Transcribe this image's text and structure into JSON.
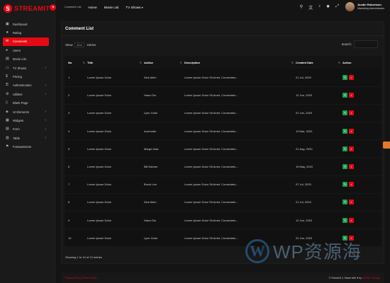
{
  "brand": {
    "name": "STREAMIT",
    "mark": "S"
  },
  "sidebar": {
    "items": [
      {
        "label": "Dashboard",
        "icon": "dashboard-icon",
        "glyph": "▣"
      },
      {
        "label": "Rating",
        "icon": "star-icon",
        "glyph": "★"
      },
      {
        "label": "Comments",
        "icon": "comment-icon",
        "glyph": "✉",
        "active": true
      },
      {
        "label": "Users",
        "icon": "user-icon",
        "glyph": "●"
      },
      {
        "label": "Movie List",
        "icon": "film-icon",
        "glyph": "▤"
      },
      {
        "label": "TV Shows",
        "icon": "tv-icon",
        "glyph": "▭",
        "chevron": true
      },
      {
        "label": "Pricing",
        "icon": "price-icon",
        "glyph": "$"
      },
      {
        "label": "Authentication",
        "icon": "lock-icon",
        "glyph": "⚿",
        "chevron": true
      },
      {
        "label": "Utilities",
        "icon": "tool-icon",
        "glyph": "⚙",
        "chevron": true
      },
      {
        "label": "Blank Page",
        "icon": "page-icon",
        "glyph": "▯"
      },
      {
        "label": "UI Elements",
        "icon": "layers-icon",
        "glyph": "◈",
        "chevron": true
      },
      {
        "label": "Widgets",
        "icon": "widget-icon",
        "glyph": "▦",
        "chevron": true
      },
      {
        "label": "Form",
        "icon": "form-icon",
        "glyph": "▤",
        "chevron": true
      },
      {
        "label": "Table",
        "icon": "table-icon",
        "glyph": "▥",
        "chevron": true
      },
      {
        "label": "Fontawesome",
        "icon": "flag-icon",
        "glyph": "⚑"
      }
    ]
  },
  "topbar": {
    "links": [
      "Comment List",
      "Home",
      "Movie List",
      "TV Shows"
    ],
    "user_name": "Austin Robertson",
    "user_role": "Marketing Administrator"
  },
  "card": {
    "title": "Comment List",
    "show_label": "Show",
    "show_value": "10",
    "entries_label": "entries",
    "search_label": "Search:",
    "info": "Showing 1 to 10 of 12 entries"
  },
  "table": {
    "headers": [
      "No",
      "Title",
      "Author",
      "Description",
      "Created Date",
      "Action"
    ],
    "rows": [
      {
        "no": "1",
        "title": "Lorem Ipsum Dolor",
        "author": "Nick Allen",
        "desc": "Lorem Ipsum Dolor Sit Amet, Consectetu...",
        "date": "21 Jul, 2020"
      },
      {
        "no": "2",
        "title": "Lorem Ipsum Dolor",
        "author": "Hana Olo",
        "desc": "Lorem Ipsum Dolor Sit Amet, Consectetu...",
        "date": "12 Jun, 2020"
      },
      {
        "no": "3",
        "title": "Lorem Ipsum Dolor",
        "author": "Lynn Guini",
        "desc": "Lorem Ipsum Dolor Sit Amet, Consectetu...",
        "date": "01 Jun, 2020"
      },
      {
        "no": "4",
        "title": "Lorem Ipsum Dolor",
        "author": "Aorrinotto",
        "desc": "Lorem Ipsum Dolor Sit Amet, Consectetu...",
        "date": "19 Mar, 2020"
      },
      {
        "no": "5",
        "title": "Lorem Ipsum Dolor",
        "author": "Marge Arita",
        "desc": "Lorem Ipsum Dolor Sit Amet, Consectetu...",
        "date": "21 Aug, 2020"
      },
      {
        "no": "6",
        "title": "Lorem Ipsum Dolor",
        "author": "Bill Dahner",
        "desc": "Lorem Ipsum Dolor Sit Amet, Consectetu...",
        "date": "10 May, 2020"
      },
      {
        "no": "7",
        "title": "Lorem Ipsum Dolor",
        "author": "Brock Lee",
        "desc": "Lorem Ipsum Dolor Sit Amet, Consectetu...",
        "date": "07 Jul, 2020"
      },
      {
        "no": "8",
        "title": "Lorem Ipsum Dolor",
        "author": "Nick Allen",
        "desc": "Lorem Ipsum Dolor Sit Amet, Consectetu...",
        "date": "21 Jul, 2020"
      },
      {
        "no": "9",
        "title": "Lorem Ipsum Dolor",
        "author": "Hana Olo",
        "desc": "Lorem Ipsum Dolor Sit Amet, Consectetu...",
        "date": "12 Jun, 2020"
      },
      {
        "no": "10",
        "title": "Lorem Ipsum Dolor",
        "author": "Lynn Guini",
        "desc": "Lorem Ipsum Dolor Sit Amet, Consectetu...",
        "date": "01 Jun, 2020"
      }
    ]
  },
  "footer": {
    "links": "Privacy Policy   Terms of Use",
    "copy": "© Streamit 3, Made with ♥ by",
    "company": "IQONIC Design"
  },
  "watermark": {
    "text": "WP资源海",
    "mark": "W"
  },
  "colors": {
    "accent": "#e50914",
    "edit": "#1aa053",
    "bg": "#141414"
  }
}
